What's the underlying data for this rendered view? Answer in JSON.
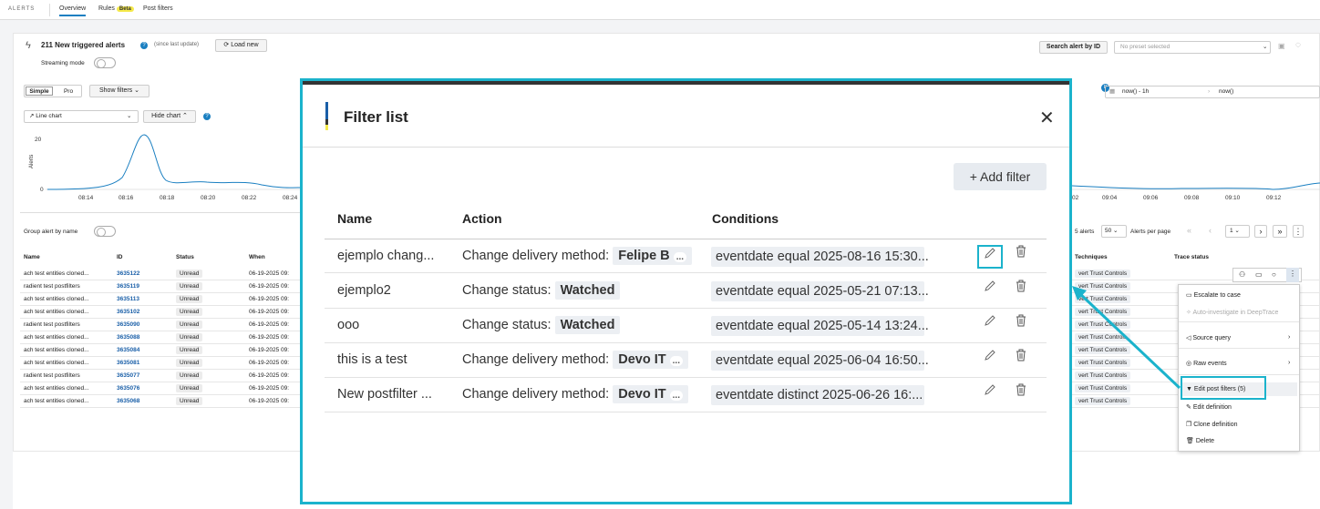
{
  "nav": {
    "brand": "ALERTS",
    "tabs": [
      {
        "label": "Overview"
      },
      {
        "label": "Rules"
      },
      {
        "label": "Post filters"
      }
    ],
    "beta": "Beta"
  },
  "header": {
    "triggered": "211 New triggered alerts",
    "since": "(since last update)",
    "load_new": "Load new",
    "streaming": "Streaming mode",
    "search_by_id": "Search alert by ID",
    "preset_placeholder": "No preset selected"
  },
  "chart_controls": {
    "simple": "Simple",
    "pro": "Pro",
    "show_filters": "Show filters",
    "chart_type": "Line chart",
    "hide_chart": "Hide chart",
    "time_from": "now() - 1h",
    "time_to": "now()"
  },
  "chart_data": {
    "type": "line",
    "ylabel": "Alerts",
    "yticks": [
      "20",
      "0"
    ],
    "xticks_left": [
      "08:14",
      "08:16",
      "08:18",
      "08:20",
      "08:22",
      "08:24"
    ],
    "xticks_right": [
      "02",
      "09:04",
      "09:06",
      "09:08",
      "09:10",
      "09:12"
    ]
  },
  "table": {
    "group_label": "Group alert by name",
    "columns": [
      "Name",
      "ID",
      "Status",
      "When"
    ],
    "columns_right": [
      "Techniques",
      "Trace status"
    ],
    "pagination": {
      "alerts": "5 alerts",
      "per_page": "50",
      "per_page_label": "Alerts per page",
      "page": "1"
    },
    "rows": [
      {
        "name": "ach test entities cloned...",
        "id": "3635122",
        "status": "Unread",
        "when": "06-19-2025 09:",
        "tech": "vert Trust Controls"
      },
      {
        "name": "radient test postfilters",
        "id": "3635119",
        "status": "Unread",
        "when": "06-19-2025 09:",
        "tech": "vert Trust Controls"
      },
      {
        "name": "ach test entities cloned...",
        "id": "3635113",
        "status": "Unread",
        "when": "06-19-2025 09:",
        "tech": "vert Trust Controls"
      },
      {
        "name": "ach test entities cloned...",
        "id": "3635102",
        "status": "Unread",
        "when": "06-19-2025 09:",
        "tech": "vert Trust Controls"
      },
      {
        "name": "radient test postfilters",
        "id": "3635090",
        "status": "Unread",
        "when": "06-19-2025 09:",
        "tech": "vert Trust Controls"
      },
      {
        "name": "ach test entities cloned...",
        "id": "3635088",
        "status": "Unread",
        "when": "06-19-2025 09:",
        "tech": "vert Trust Controls"
      },
      {
        "name": "ach test entities cloned...",
        "id": "3635084",
        "status": "Unread",
        "when": "06-19-2025 09:",
        "tech": "vert Trust Controls"
      },
      {
        "name": "ach test entities cloned...",
        "id": "3635081",
        "status": "Unread",
        "when": "06-19-2025 09:",
        "tech": "vert Trust Controls"
      },
      {
        "name": "radient test postfilters",
        "id": "3635077",
        "status": "Unread",
        "when": "06-19-2025 09:",
        "tech": "vert Trust Controls"
      },
      {
        "name": "ach test entities cloned...",
        "id": "3635076",
        "status": "Unread",
        "when": "06-19-2025 09:",
        "tech": "vert Trust Controls"
      },
      {
        "name": "ach test entities cloned...",
        "id": "3635068",
        "status": "Unread",
        "when": "06-19-2025 09:",
        "tech": "vert Trust Controls"
      }
    ]
  },
  "context_menu": {
    "items": [
      {
        "label": "Escalate to case",
        "icon": "case-icon"
      },
      {
        "label": "Auto-investigate in DeepTrace",
        "icon": "sparkle-icon",
        "disabled": true
      },
      {
        "label": "Source query",
        "icon": "source-icon"
      },
      {
        "label": "Raw events",
        "icon": "events-icon"
      },
      {
        "label": "Edit post filters (5)",
        "icon": "filter-icon"
      },
      {
        "label": "Edit definition",
        "icon": "pencil-icon"
      },
      {
        "label": "Clone definition",
        "icon": "clone-icon"
      },
      {
        "label": "Delete",
        "icon": "trash-icon"
      }
    ]
  },
  "modal": {
    "title": "Filter list",
    "add_filter": "Add filter",
    "columns": {
      "name": "Name",
      "action": "Action",
      "conditions": "Conditions"
    },
    "filters": [
      {
        "name": "ejemplo chang...",
        "action": "Change delivery method:",
        "value": "Felipe B",
        "more": "...",
        "condition": "eventdate equal 2025-08-16 15:30..."
      },
      {
        "name": "ejemplo2",
        "action": "Change status:",
        "value": "Watched",
        "more": "",
        "condition": "eventdate equal 2025-05-21 07:13..."
      },
      {
        "name": "ooo",
        "action": "Change status:",
        "value": "Watched",
        "more": "",
        "condition": "eventdate equal 2025-05-14 13:24..."
      },
      {
        "name": "this is a test",
        "action": "Change delivery method:",
        "value": "Devo IT",
        "more": "...",
        "condition": "eventdate equal 2025-06-04 16:50..."
      },
      {
        "name": "New postfilter ...",
        "action": "Change delivery method:",
        "value": "Devo IT",
        "more": "...",
        "condition": "eventdate distinct 2025-06-26 16:..."
      }
    ]
  },
  "colors": {
    "accent": "#1bb3cc",
    "link": "#1a5fa8",
    "brand_blue": "#1a7fc1"
  }
}
